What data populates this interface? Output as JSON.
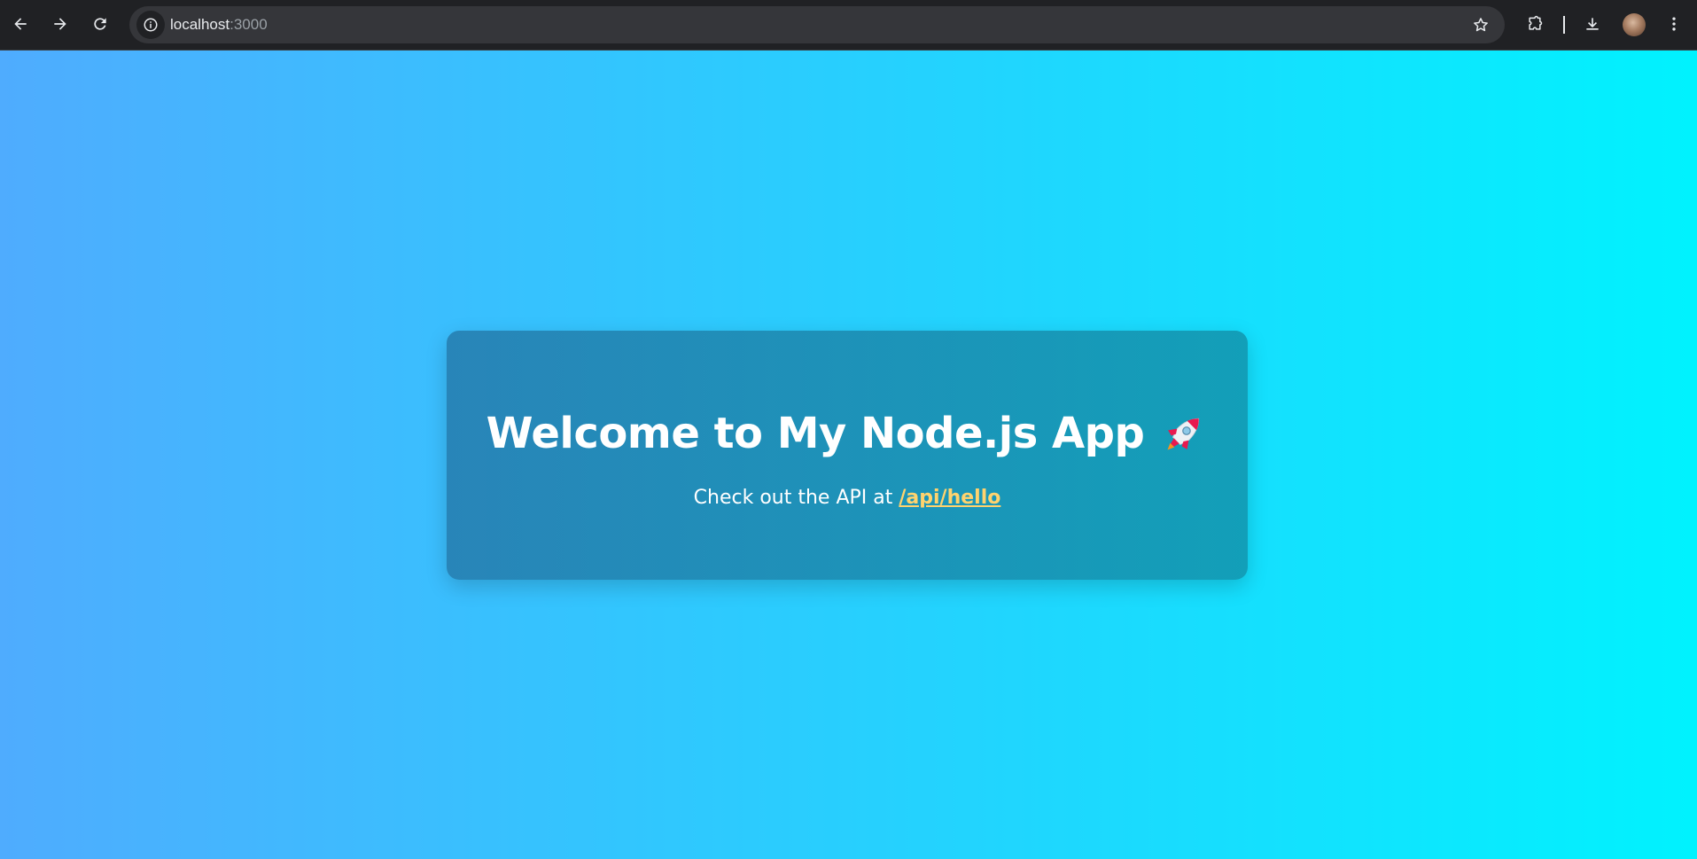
{
  "browser": {
    "url_host": "localhost",
    "url_port": ":3000",
    "icons": {
      "back": "arrow-left-icon",
      "forward": "arrow-right-icon",
      "reload": "reload-icon",
      "site_info": "info-icon",
      "bookmark": "star-icon",
      "extensions": "puzzle-icon",
      "downloads": "download-icon",
      "menu": "kebab-menu-icon"
    },
    "chrome_color": "#202124"
  },
  "page": {
    "background_gradient": [
      "#4facfe",
      "#00f2fe"
    ],
    "card": {
      "title": "Welcome to My Node.js App",
      "title_icon": "rocket-icon",
      "subtitle_prefix": "Check out the API at",
      "link_text": "/api/hello",
      "link_color": "#ffd36e"
    }
  }
}
